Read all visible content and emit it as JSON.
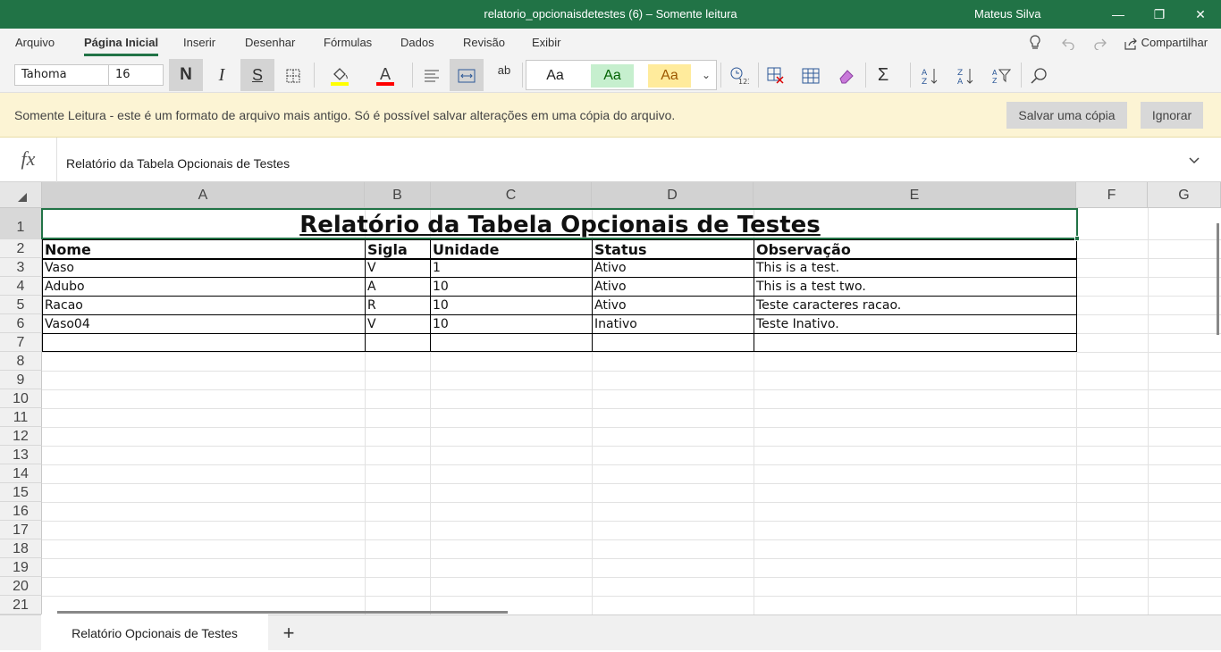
{
  "window": {
    "title": "relatorio_opcionaisdetestes (6) – Somente leitura",
    "user": "Mateus Silva",
    "minimize_glyph": "—",
    "restore_glyph": "❐",
    "close_glyph": "✕"
  },
  "menu": {
    "items": [
      "Arquivo",
      "Página Inicial",
      "Inserir",
      "Desenhar",
      "Fórmulas",
      "Dados",
      "Revisão",
      "Exibir"
    ],
    "active": "Página Inicial",
    "share_label": "Compartilhar"
  },
  "toolbar": {
    "font_name": "Tahoma",
    "font_size": "16",
    "bold_label": "N",
    "italic_label": "I",
    "underline_label": "S",
    "wrap_label": "ab",
    "styles": [
      "Aa",
      "Aa",
      "Aa"
    ],
    "style_colors": [
      "#ffffff",
      "#c6efce",
      "#ffeb9c"
    ],
    "fill_color": "#ffff00",
    "font_color": "#ff0000"
  },
  "infobar": {
    "message": "Somente Leitura - este é um formato de arquivo mais antigo. Só é possível salvar alterações em uma cópia do arquivo.",
    "save_copy": "Salvar uma cópia",
    "ignore": "Ignorar"
  },
  "formula_bar": {
    "fx_label": "fx",
    "value": "Relatório da Tabela Opcionais de Testes"
  },
  "sheet": {
    "columns": [
      "A",
      "B",
      "C",
      "D",
      "E",
      "F",
      "G"
    ],
    "row_numbers": [
      "1",
      "2",
      "3",
      "4",
      "5",
      "6",
      "7",
      "8",
      "9",
      "10",
      "11",
      "12",
      "13",
      "14",
      "15",
      "16",
      "17",
      "18",
      "19",
      "20",
      "21"
    ],
    "title": "Relatório da Tabela Opcionais de Testes",
    "headers": [
      "Nome",
      "Sigla",
      "Unidade",
      "Status",
      "Observação"
    ],
    "rows": [
      [
        "Vaso",
        "V",
        "1",
        "Ativo",
        "This is a test."
      ],
      [
        "Adubo",
        "A",
        "10",
        "Ativo",
        "This is a test two."
      ],
      [
        "Racao",
        "R",
        "10",
        "Ativo",
        "Teste caracteres racao."
      ],
      [
        "Vaso04",
        "V",
        "10",
        "Inativo",
        "Teste Inativo."
      ]
    ]
  },
  "tabs": {
    "sheet_name": "Relatório Opcionais de Testes",
    "add_label": "+"
  },
  "accent_color": "#217346"
}
